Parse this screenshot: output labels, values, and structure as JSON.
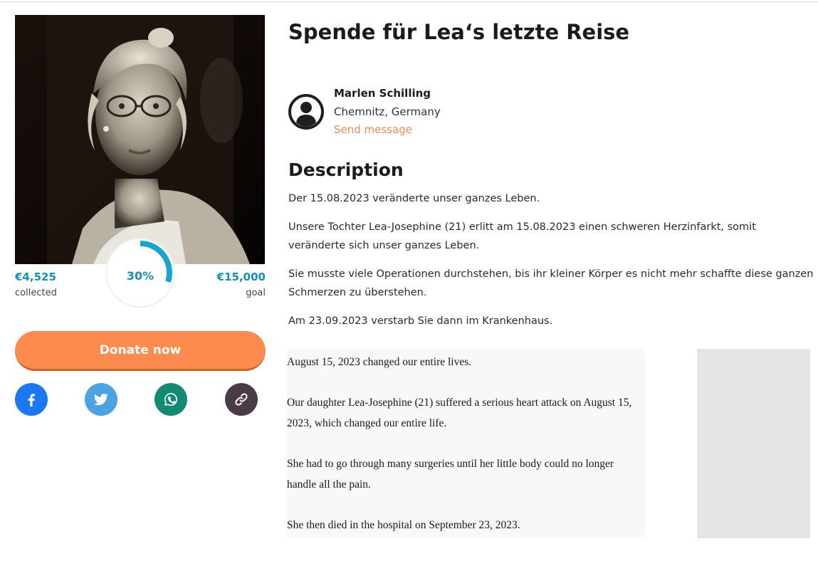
{
  "campaign": {
    "title": "Spende für Lea‘s letzte Reise"
  },
  "progress": {
    "collected_amount": "€4,525",
    "collected_label": "collected",
    "goal_amount": "€15,000",
    "goal_label": "goal",
    "percent_label": "30%",
    "fraction": 0.3,
    "color": "#1a8fb5"
  },
  "actions": {
    "donate_label": "Donate now",
    "donate_color": "#fd8a4e",
    "share": [
      {
        "icon": "facebook-icon",
        "color": "#1c77f2"
      },
      {
        "icon": "twitter-icon",
        "color": "#4ba3e3"
      },
      {
        "icon": "whatsapp-icon",
        "color": "#158a72"
      },
      {
        "icon": "link-icon",
        "color": "#4a3c47"
      }
    ]
  },
  "author": {
    "name": "Marlen Schilling",
    "location": "Chemnitz, Germany",
    "message_link": "Send message",
    "avatar_icon": "user-avatar-icon"
  },
  "description": {
    "heading": "Description",
    "paragraphs": [
      "Der 15.08.2023 veränderte unser ganzes Leben.",
      "Unsere Tochter Lea-Josephine (21) erlitt am 15.08.2023 einen schweren Herzinfarkt, somit veränderte sich unser ganzes Leben.",
      "Sie musste viele Operationen durchstehen, bis ihr kleiner Körper es nicht mehr schaffte diese ganzen Schmerzen zu überstehen.",
      "Am 23.09.2023 verstarb Sie dann im Krankenhaus."
    ]
  },
  "translation": {
    "paragraphs": [
      "August 15, 2023 changed our entire lives.",
      "Our daughter Lea-Josephine (21) suffered a serious heart attack on August 15, 2023, which changed our entire life.",
      "She had to go through many surgeries until her little body could no longer handle all the pain.",
      "She then died in the hospital on September 23, 2023."
    ]
  }
}
